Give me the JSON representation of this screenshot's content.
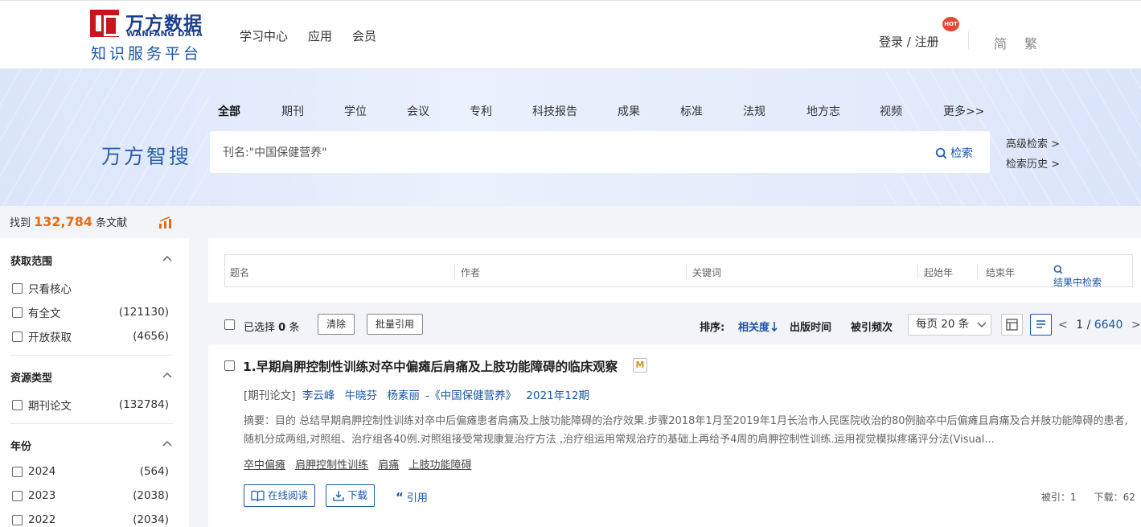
{
  "header": {
    "logo_cn": "万方数据",
    "logo_en": "WANFANG DATA",
    "logo_sub": "知识服务平台",
    "nav": [
      "学习中心",
      "应用",
      "会员"
    ],
    "login": "登录 / 注册",
    "hot_badge": "HOT",
    "lang_simplified": "简",
    "lang_traditional": "繁"
  },
  "search": {
    "categories": [
      "全部",
      "期刊",
      "学位",
      "会议",
      "专利",
      "科技报告",
      "成果",
      "标准",
      "法规",
      "地方志",
      "视频",
      "更多>>"
    ],
    "active_category": "全部",
    "brand": "万方智搜",
    "query": "刊名:\"中国保健营养\"",
    "button": "检索",
    "advanced": "高级检索 >",
    "history": "检索历史 >"
  },
  "summary": {
    "prefix": "找到",
    "count": "132,784",
    "suffix": "条文献"
  },
  "sidebar": {
    "sections": [
      {
        "title": "获取范围",
        "items": [
          {
            "label": "只看核心",
            "count": ""
          },
          {
            "label": "有全文",
            "count": "(121130)"
          },
          {
            "label": "开放获取",
            "count": "(4656)"
          }
        ]
      },
      {
        "title": "资源类型",
        "items": [
          {
            "label": "期刊论文",
            "count": "(132784)"
          }
        ]
      },
      {
        "title": "年份",
        "items": [
          {
            "label": "2024",
            "count": "(564)"
          },
          {
            "label": "2023",
            "count": "(2038)"
          },
          {
            "label": "2022",
            "count": "(2034)"
          }
        ]
      }
    ]
  },
  "filter": {
    "title_placeholder": "题名",
    "author_placeholder": "作者",
    "keyword_placeholder": "关键词",
    "start_year": "起始年",
    "end_year": "结束年",
    "search_in_results": "结果中检索"
  },
  "toolbar": {
    "selected_prefix": "已选择",
    "selected_count": "0",
    "selected_suffix": "条",
    "clear": "清除",
    "batch_cite": "批量引用",
    "sort_label": "排序:",
    "sort_relevance": "相关度",
    "sort_date": "出版时间",
    "sort_cited": "被引频次",
    "per_page": "每页 20 条",
    "page_current": "1",
    "page_sep": "/",
    "page_total": "6640"
  },
  "results": [
    {
      "title": "1.早期肩胛控制性训练对卒中偏瘫后肩痛及上肢功能障碍的临床观察",
      "badge": "M",
      "type": "[期刊论文]",
      "authors": [
        "李云峰",
        "牛晓芬",
        "杨素丽"
      ],
      "journal": "-《中国保健营养》",
      "issue": "2021年12期",
      "abstract": "摘要：目的 总结早期肩胛控制性训练对卒中后偏瘫患者肩痛及上肢功能障碍的治疗效果.步骤2018年1月至2019年1月长治市人民医院收治的80例脑卒中后偏瘫且肩痛及合并肢功能障碍的患者,随机分成两组,对照组、治疗组各40例.对照组接受常规康复治疗方法 ,治疗组运用常规治疗的基础上再给予4周的肩胛控制性训练.运用视觉模拟疼痛评分法(Visual...",
      "keywords": [
        "卒中偏瘫",
        "肩胛控制性训练",
        "肩痛",
        "上肢功能障碍"
      ],
      "read_online": "在线阅读",
      "download": "下载",
      "cite": "引用",
      "cited": "被引：1",
      "downloads": "下载：62"
    }
  ],
  "colors": {
    "brand_red": "#c8161d",
    "brand_blue": "#1a56a8",
    "count_orange": "#e86a10"
  }
}
